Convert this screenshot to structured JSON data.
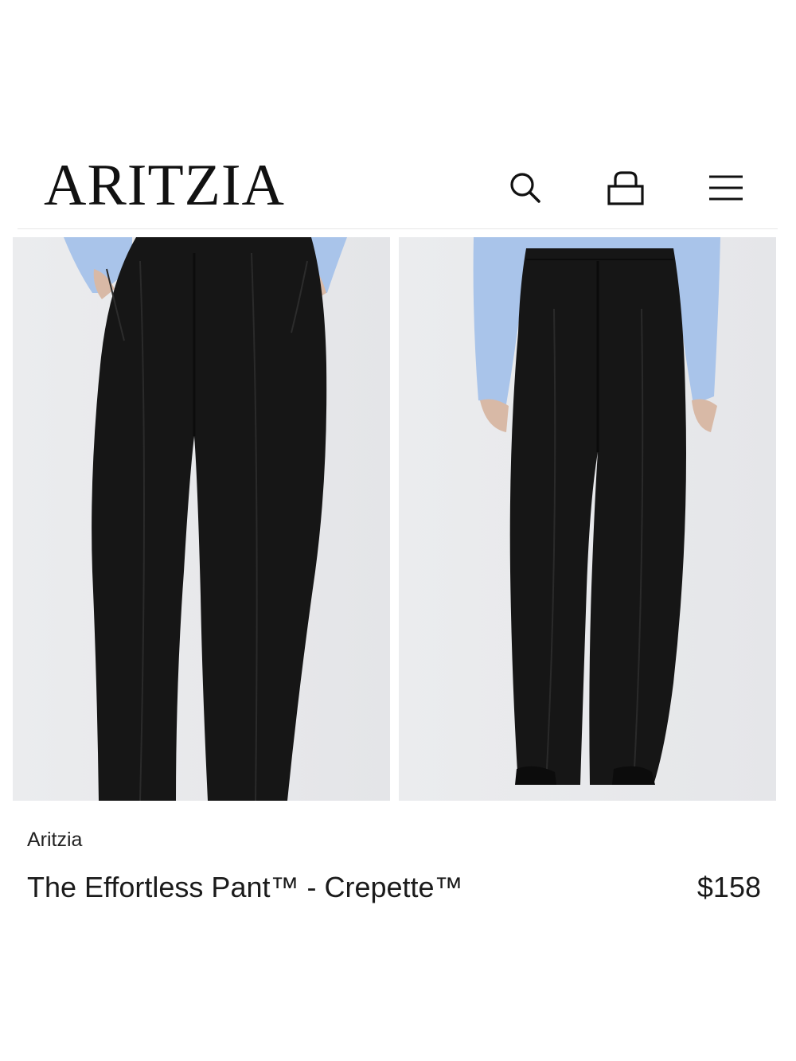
{
  "header": {
    "logo": "ARITZIA",
    "icons": [
      "search-icon",
      "bag-icon",
      "menu-icon"
    ]
  },
  "gallery": {
    "images": [
      "front-view",
      "back-view"
    ]
  },
  "product": {
    "brand": "Aritzia",
    "name": "The Effortless Pant™ - Crepette™",
    "price": "$158"
  },
  "colors": {
    "text": "#1b1b1b",
    "photo_bg": "#e8e9eb",
    "pant": "#161616",
    "shirt": "#a9c4ea"
  }
}
